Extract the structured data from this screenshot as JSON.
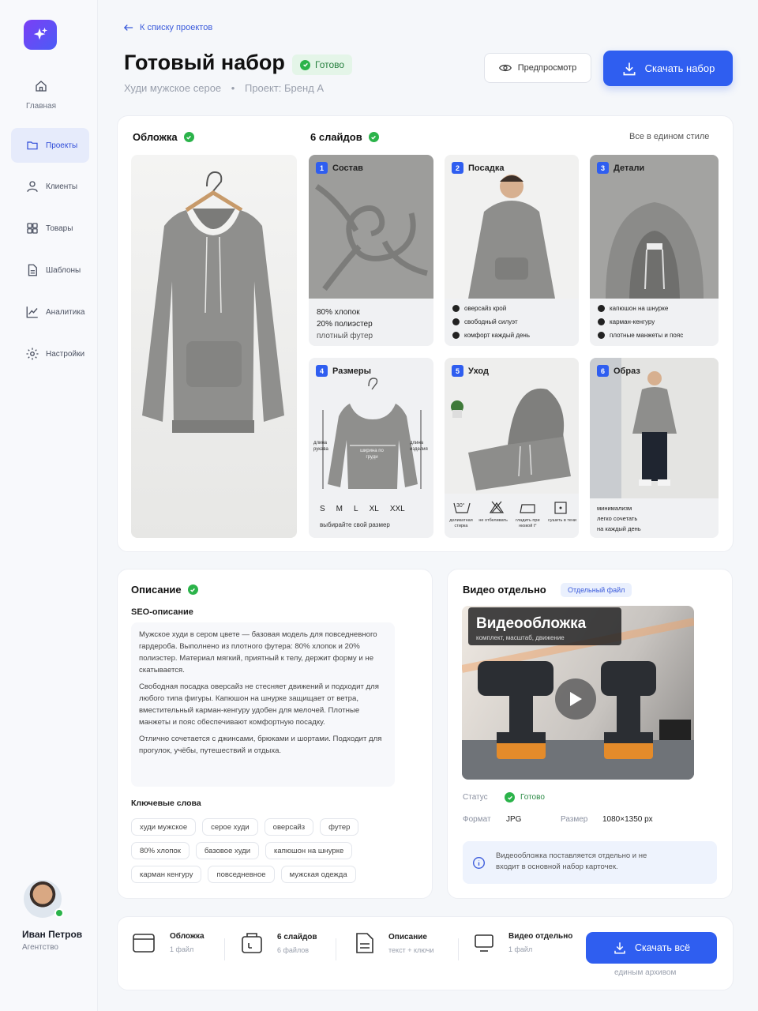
{
  "sidebar": {
    "items": [
      {
        "label": "Главная",
        "icon": "home-icon"
      },
      {
        "label": "Проекты",
        "icon": "folder-icon",
        "active": true
      },
      {
        "label": "Клиенты",
        "icon": "user-icon"
      },
      {
        "label": "Товары",
        "icon": "grid-icon"
      },
      {
        "label": "Шаблоны",
        "icon": "document-icon"
      },
      {
        "label": "Аналитика",
        "icon": "chart-icon"
      },
      {
        "label": "Настройки",
        "icon": "gear-icon"
      }
    ],
    "user": {
      "name": "Иван Петров",
      "role": "Агентство"
    }
  },
  "header": {
    "back_label": "К списку проектов",
    "title": "Готовый набор",
    "status": "Готово",
    "subtitle_product": "Худи мужское серое",
    "subtitle_project": "Проект: Бренд А",
    "preview_label": "Предпросмотр",
    "download_label": "Скачать набор"
  },
  "kit": {
    "cover_title": "Обложка",
    "slides_title": "6 слайдов",
    "same_style": "Все в едином стиле",
    "slides": [
      {
        "num": "1",
        "title": "Состав",
        "lines": [
          "80% хлопок",
          "20% полиэстер",
          "плотный футер"
        ]
      },
      {
        "num": "2",
        "title": "Посадка",
        "bullets": [
          "оверсайз крой",
          "свободный силуэт",
          "комфорт каждый день"
        ]
      },
      {
        "num": "3",
        "title": "Детали",
        "bullets": [
          "капюшон на шнурке",
          "карман-кенгуру",
          "плотные манжеты и пояс"
        ]
      },
      {
        "num": "4",
        "title": "Размеры",
        "sizes": [
          "S",
          "M",
          "L",
          "XL",
          "XXL"
        ],
        "caption": "выбирайте свой размер",
        "left_dim": "длина рукава",
        "right_dim": "длина изделия",
        "chest": "ширина по груди"
      },
      {
        "num": "5",
        "title": "Уход",
        "care": [
          "деликатная стирка",
          "не отбеливать",
          "гладить при низкой t°",
          "сушить в тени"
        ],
        "wash_temp": "30°"
      },
      {
        "num": "6",
        "title": "Образ",
        "lines": [
          "минимализм",
          "легко сочетать",
          "на каждый день"
        ]
      }
    ]
  },
  "description": {
    "title": "Описание",
    "seo_title": "SEO-описание",
    "paragraphs": [
      "Мужское худи в сером цвете — базовая модель для повседневного гардероба. Выполнено из плотного футера: 80% хлопок и 20% полиэстер. Материал мягкий, приятный к телу, держит форму и не скатывается.",
      "Свободная посадка оверсайз не стесняет движений и подходит для любого типа фигуры. Капюшон на шнурке защищает от ветра, вместительный карман-кенгуру удобен для мелочей. Плотные манжеты и пояс обеспечивают комфортную посадку.",
      "Отлично сочетается с джинсами, брюками и шортами. Подходит для прогулок, учёбы, путешествий и отдыха."
    ],
    "keywords_title": "Ключевые слова",
    "keywords": [
      "худи мужское",
      "серое худи",
      "оверсайз",
      "футер",
      "80% хлопок",
      "базовое худи",
      "капюшон на шнурке",
      "карман кенгуру",
      "повседневное",
      "мужская одежда"
    ]
  },
  "video": {
    "title": "Видео отдельно",
    "badge": "Отдельный файл",
    "cover_title": "Видеообложка",
    "cover_subtitle": "комплект, масштаб, движение",
    "status_label": "Статус",
    "status_value": "Готово",
    "format_label": "Формат",
    "format_value": "JPG",
    "size_label": "Размер",
    "size_value": "1080×1350 px",
    "note": "Видеообложка поставляется отдельно и не входит в основной набор карточек."
  },
  "footer": {
    "items": [
      {
        "title": "Обложка",
        "sub": "1 файл"
      },
      {
        "title": "6 слайдов",
        "sub": "6 файлов"
      },
      {
        "title": "Описание",
        "sub": "текст + ключи"
      },
      {
        "title": "Видео отдельно",
        "sub": "1 файл"
      }
    ],
    "download_all": "Скачать всё",
    "archive_note": "единым архивом"
  },
  "colors": {
    "accent": "#2f5ef0",
    "success": "#2bb34a",
    "brand": "#6a45f5"
  }
}
